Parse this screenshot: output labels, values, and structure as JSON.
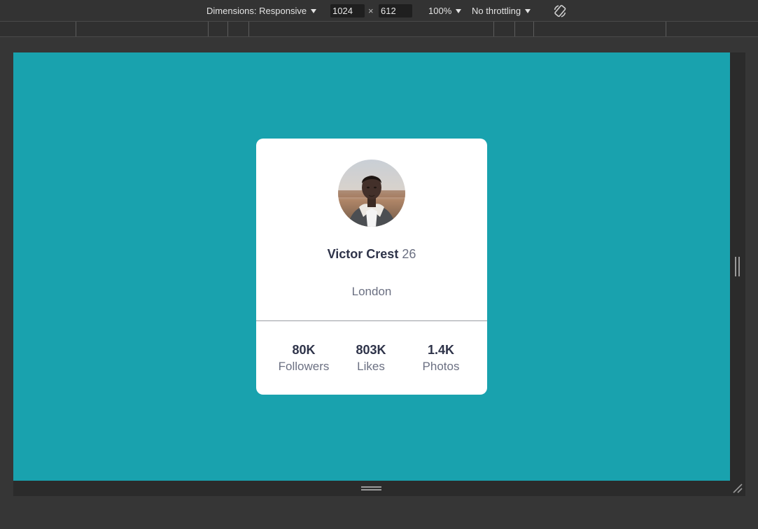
{
  "toolbar": {
    "dimensions_label": "Dimensions: Responsive",
    "width_value": "1024",
    "times_symbol": "×",
    "height_value": "612",
    "zoom_label": "100%",
    "throttling_label": "No throttling",
    "rotate_icon": "rotate-icon"
  },
  "profile": {
    "name": "Victor Crest",
    "age": "26",
    "city": "London",
    "stats": [
      {
        "value": "80K",
        "label": "Followers"
      },
      {
        "value": "803K",
        "label": "Likes"
      },
      {
        "value": "1.4K",
        "label": "Photos"
      }
    ]
  },
  "colors": {
    "page_background": "#19a2ae",
    "card_background": "#ffffff",
    "text_dark": "#2e3349",
    "text_muted": "#6b7082"
  }
}
